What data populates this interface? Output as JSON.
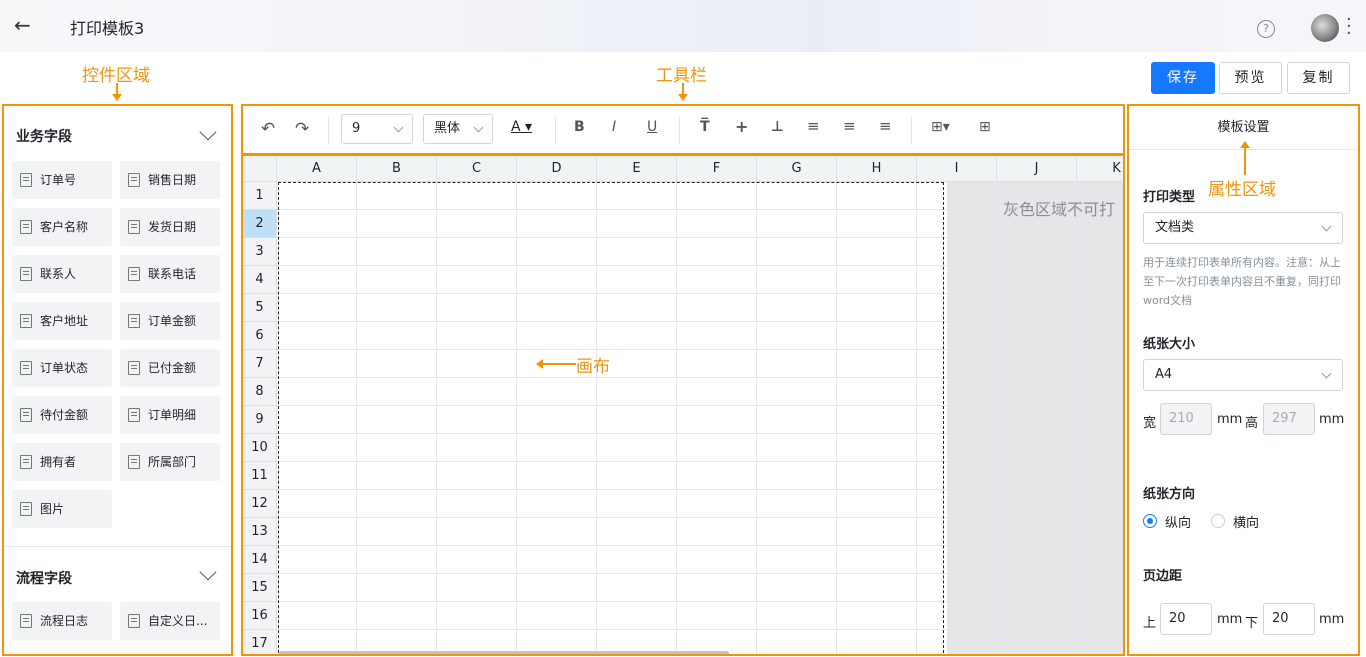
{
  "header": {
    "title": "打印模板3",
    "help_icon": "?"
  },
  "annotations": {
    "controls_area": "控件区域",
    "toolbar": "工具栏",
    "canvas": "画布",
    "properties_area": "属性区域"
  },
  "actions": {
    "save": "保存",
    "preview": "预览",
    "copy": "复制"
  },
  "left_panel": {
    "business_fields": {
      "title": "业务字段",
      "items": [
        "订单号",
        "销售日期",
        "客户名称",
        "发货日期",
        "联系人",
        "联系电话",
        "客户地址",
        "订单金额",
        "订单状态",
        "已付金额",
        "待付金额",
        "订单明细",
        "拥有者",
        "所属部门",
        "图片"
      ]
    },
    "process_fields": {
      "title": "流程字段",
      "items": [
        "流程日志",
        "自定义日..."
      ]
    }
  },
  "toolbar": {
    "undo": "↶",
    "redo": "↷",
    "font_size": "9",
    "font_family": "黑体",
    "font_color": "A",
    "bold": "B",
    "italic": "I",
    "underline": "U"
  },
  "canvas": {
    "columns": [
      "A",
      "B",
      "C",
      "D",
      "E",
      "F",
      "G",
      "H",
      "I",
      "J",
      "K"
    ],
    "rows": [
      "1",
      "2",
      "3",
      "4",
      "5",
      "6",
      "7",
      "8",
      "9",
      "10",
      "11",
      "12",
      "13",
      "14",
      "15",
      "16",
      "17"
    ],
    "selected_row": "2",
    "gray_note": "灰色区域不可打"
  },
  "right_panel": {
    "title": "模板设置",
    "print_type_label": "打印类型",
    "print_type_value": "文档类",
    "print_type_hint": "用于连续打印表单所有内容。注意：从上至下一次打印表单内容且不重复，同打印word文档",
    "paper_size_label": "纸张大小",
    "paper_size_value": "A4",
    "width_label": "宽",
    "width_value": "210",
    "height_label": "高",
    "height_value": "297",
    "unit": "mm",
    "orientation_label": "纸张方向",
    "portrait": "纵向",
    "landscape": "横向",
    "margin_label": "页边距",
    "top_label": "上",
    "top_value": "20",
    "bottom_label": "下",
    "bottom_value": "20"
  },
  "colors": {
    "accent": "#1677ff",
    "annotation": "#f0940a"
  }
}
